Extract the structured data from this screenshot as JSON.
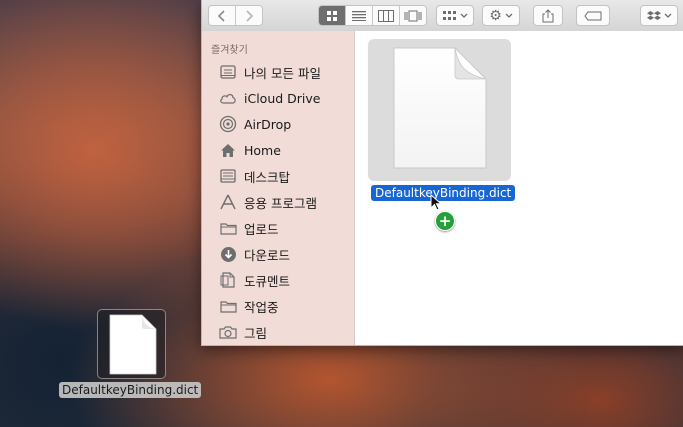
{
  "toolbar": {
    "back_icon": "chevron-left-icon",
    "forward_icon": "chevron-right-icon",
    "view_modes": [
      "icon-view-icon",
      "list-view-icon",
      "column-view-icon",
      "cover-flow-icon"
    ],
    "active_view": "icon-view-icon",
    "arrange_icon": "arrange-grid-icon",
    "action_icon": "gear-icon",
    "share_icon": "share-icon",
    "tag_icon": "tag-icon",
    "dropbox_icon": "dropbox-icon"
  },
  "sidebar": {
    "section_title": "즐겨찾기",
    "items": [
      {
        "label": "나의 모든 파일",
        "icon": "all-files-icon"
      },
      {
        "label": "iCloud Drive",
        "icon": "cloud-icon"
      },
      {
        "label": "AirDrop",
        "icon": "airdrop-icon"
      },
      {
        "label": "Home",
        "icon": "home-icon"
      },
      {
        "label": "데스크탑",
        "icon": "desktop-icon"
      },
      {
        "label": "응용 프로그램",
        "icon": "applications-icon"
      },
      {
        "label": "업로드",
        "icon": "folder-icon"
      },
      {
        "label": "다운로드",
        "icon": "download-icon"
      },
      {
        "label": "도큐멘트",
        "icon": "documents-icon"
      },
      {
        "label": "작업중",
        "icon": "folder-icon"
      },
      {
        "label": "그림",
        "icon": "camera-icon"
      }
    ]
  },
  "content": {
    "file_name": "DefaultkeyBinding.dict",
    "copy_badge": "+"
  },
  "drag": {
    "file_name": "DefaultkeyBinding.dict"
  },
  "colors": {
    "selection": "#1666d3",
    "sidebar_bg": "#f1dcd7",
    "copy_badge": "#27a03b"
  }
}
